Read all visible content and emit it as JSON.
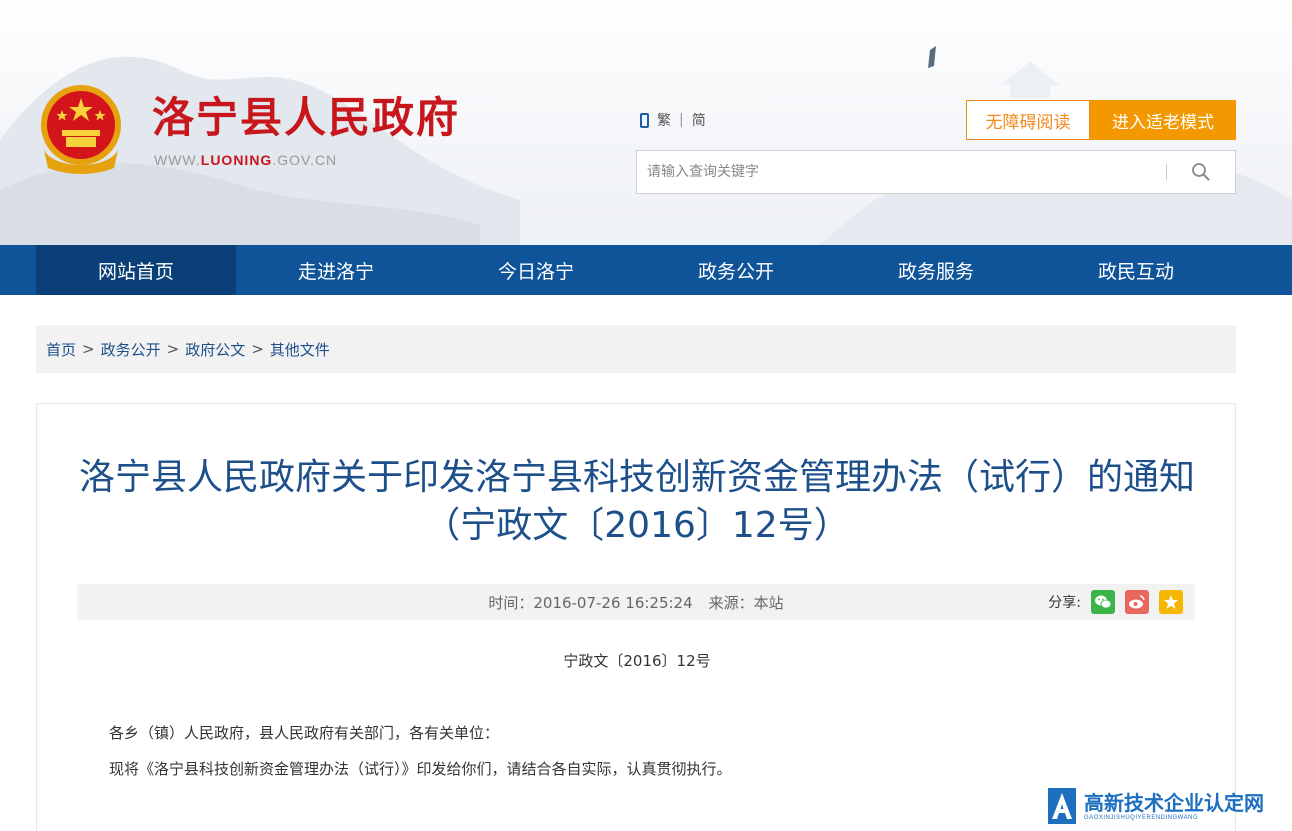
{
  "header": {
    "site_name": "洛宁县人民政府",
    "url_prefix": "WWW.",
    "url_brand": "LUONING",
    "url_suffix": ".GOV.CN",
    "lang_traditional": "繁",
    "lang_separator": "|",
    "lang_simplified": "简",
    "accessibility_button": "无障碍阅读",
    "elder_mode_button": "进入适老模式",
    "search_placeholder": "请输入查询关键字"
  },
  "nav": {
    "items": [
      {
        "label": "网站首页",
        "active": true
      },
      {
        "label": "走进洛宁",
        "active": false
      },
      {
        "label": "今日洛宁",
        "active": false
      },
      {
        "label": "政务公开",
        "active": false
      },
      {
        "label": "政务服务",
        "active": false
      },
      {
        "label": "政民互动",
        "active": false
      }
    ]
  },
  "breadcrumb": {
    "items": [
      "首页",
      "政务公开",
      "政府公文",
      "其他文件"
    ],
    "separator": ">"
  },
  "article": {
    "title": "洛宁县人民政府关于印发洛宁县科技创新资金管理办法（试行）的通知（宁政文〔2016〕12号）",
    "time_label": "时间：",
    "time_value": "2016-07-26 16:25:24",
    "source_label": "来源：",
    "source_value": "本站",
    "share_label": "分享:",
    "doc_number": "宁政文〔2016〕12号",
    "paragraph1": "各乡（镇）人民政府，县人民政府有关部门，各有关单位：",
    "paragraph2": "现将《洛宁县科技创新资金管理办法（试行）》印发给你们，请结合各自实际，认真贯彻执行。"
  },
  "watermark": {
    "title": "高新技术企业认定网",
    "subtitle": "GAOXINJISHUQIYERENDINGWANG"
  },
  "colors": {
    "nav_bg": "#0f5499",
    "nav_active": "#0b3f77",
    "brand_red": "#c8161d",
    "title_blue": "#1d4f8b",
    "orange": "#f39800"
  },
  "icons": [
    "emblem-icon",
    "phone-icon",
    "search-icon",
    "wechat-icon",
    "weibo-icon",
    "favorite-icon"
  ]
}
